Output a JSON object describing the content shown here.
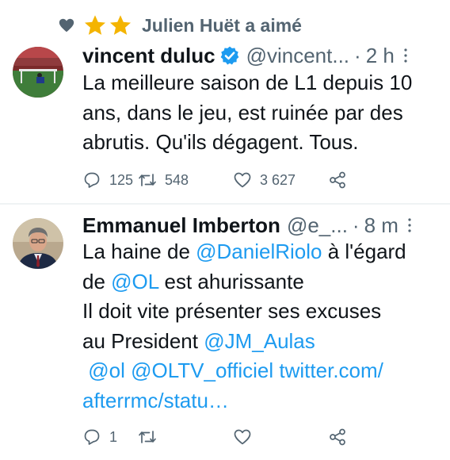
{
  "social_context": {
    "text": "Julien Huët a aimé"
  },
  "tweets": [
    {
      "author": {
        "name": "vincent duluc",
        "handle": "@vincent...",
        "verified": true
      },
      "time": "2 h",
      "text_lines": [
        "La meilleure saison de L1 depuis 10",
        "ans, dans le jeu, est ruinée par des",
        "abrutis. Qu'ils dégagent. Tous."
      ],
      "stats": {
        "replies": "125",
        "retweets": "548",
        "likes": "3 627"
      }
    },
    {
      "author": {
        "name": "Emmanuel Imberton",
        "handle": "@e_...",
        "verified": false
      },
      "time": "8 m",
      "text": {
        "l1_a": "La haine de ",
        "m1": "@DanielRiolo",
        "l1_b": " à l'égard",
        "l2_a": "de ",
        "m2": "@OL",
        "l2_b": " est ahurissante",
        "l3": "Il doit vite présenter ses excuses",
        "l4_a": "au President ",
        "m3": "@JM_Aulas",
        "m4": "@ol",
        "m5": "@OLTV_officiel",
        "link_a": "twitter.com/",
        "link_b": "afterrmc/statu…"
      },
      "stats": {
        "replies": "1",
        "retweets": "",
        "likes": ""
      }
    }
  ],
  "separator": "·",
  "colors": {
    "accent": "#1d9bf0",
    "secondary": "#536471",
    "star": "#f4b400",
    "text": "#0f1419"
  },
  "icons": [
    "heart-icon",
    "star-icon",
    "verified-badge-icon",
    "more-icon",
    "reply-icon",
    "retweet-icon",
    "like-icon",
    "share-icon"
  ]
}
